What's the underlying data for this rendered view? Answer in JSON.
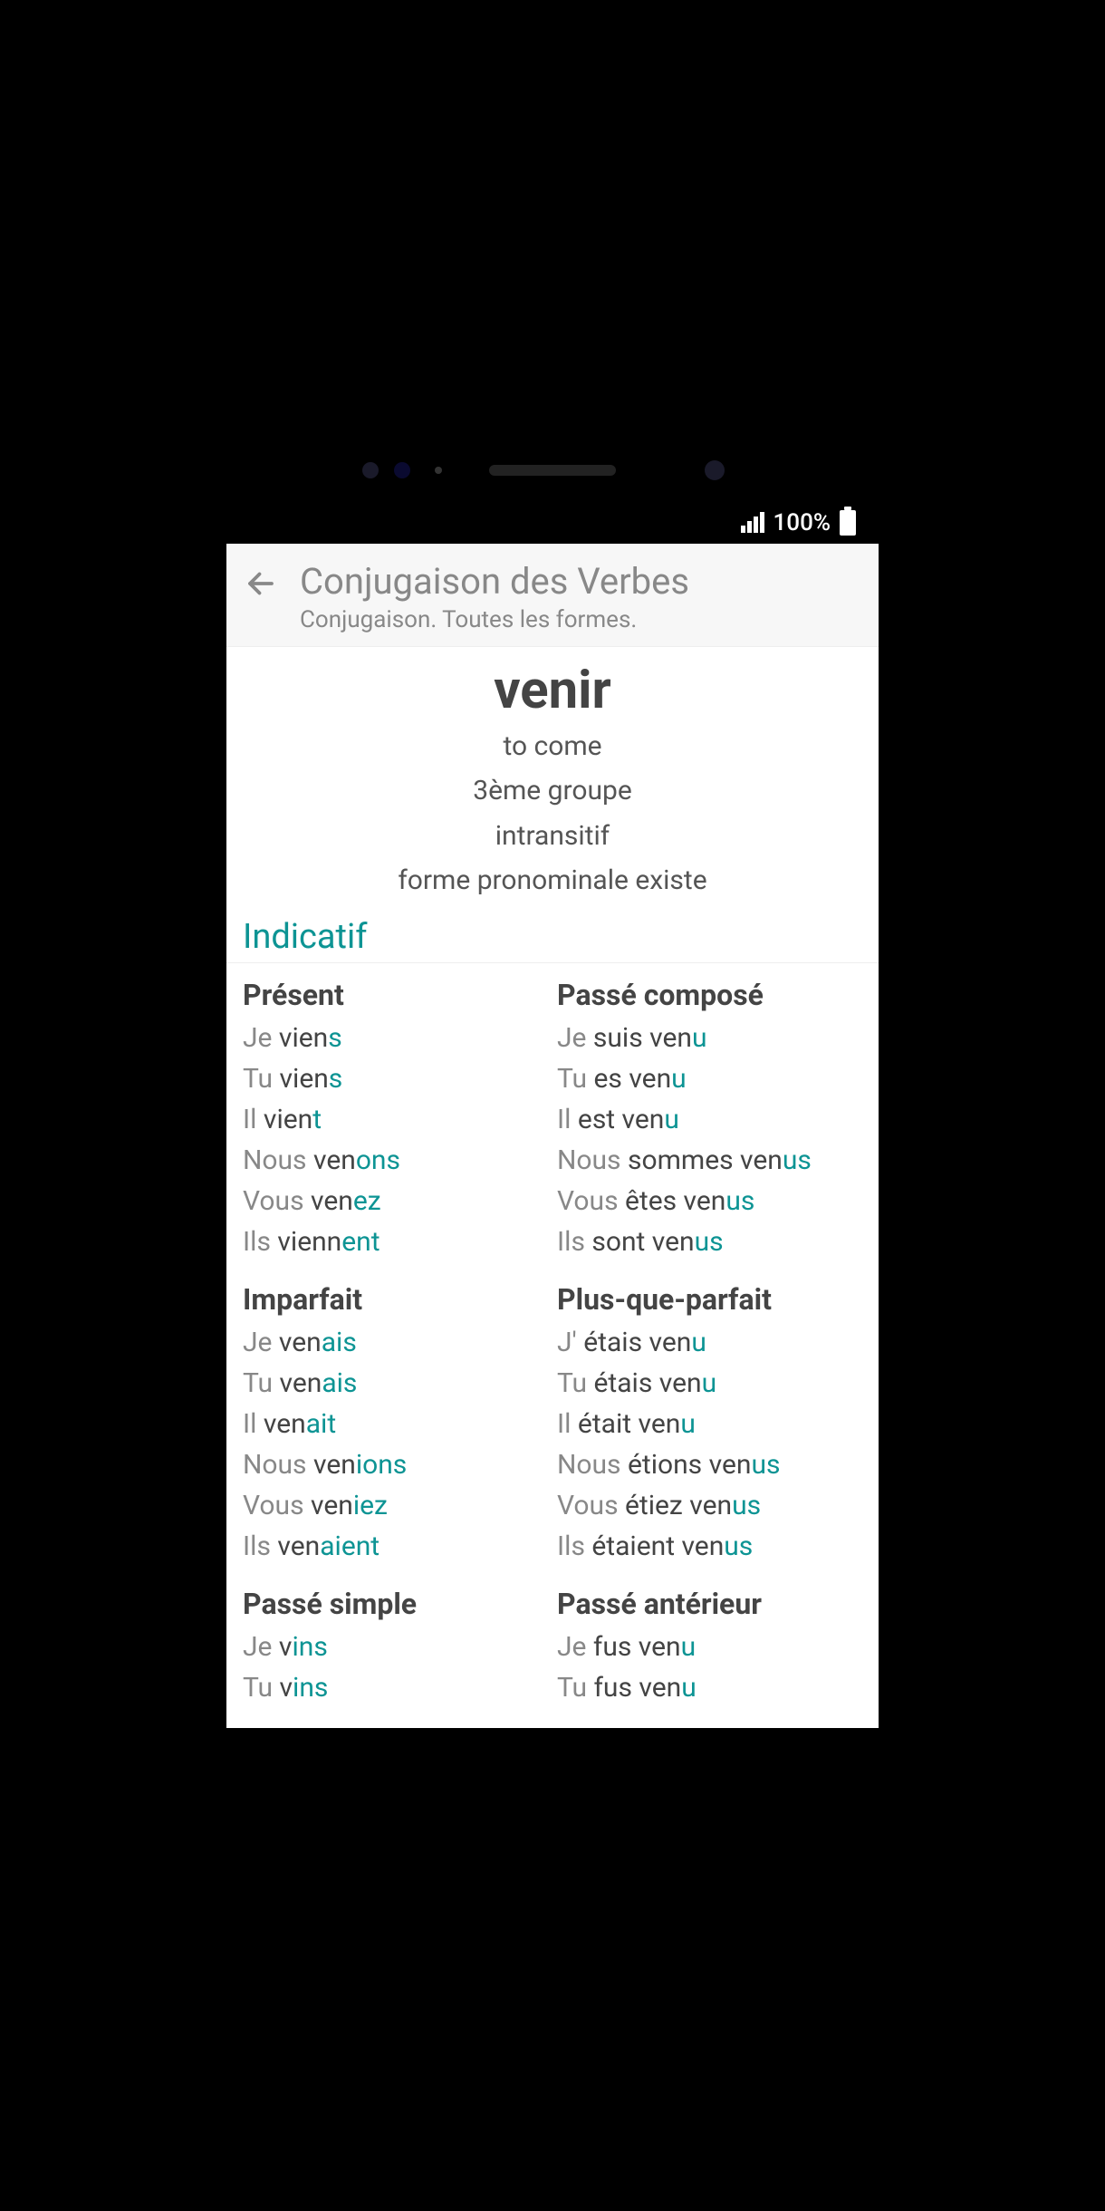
{
  "status": {
    "battery": "100%"
  },
  "header": {
    "title": "Conjugaison des Verbes",
    "subtitle": "Conjugaison. Toutes les formes."
  },
  "verb": {
    "infinitive": "venir",
    "translation": "to come",
    "group": "3ème groupe",
    "transitivity": "intransitif",
    "pronominal": "forme pronominale existe"
  },
  "mood": "Indicatif",
  "tenses": [
    {
      "name": "Présent",
      "forms": [
        {
          "pronoun": "Je",
          "stem": " vien",
          "ending": "s"
        },
        {
          "pronoun": "Tu",
          "stem": " vien",
          "ending": "s"
        },
        {
          "pronoun": "Il",
          "stem": " vien",
          "ending": "t"
        },
        {
          "pronoun": "Nous",
          "stem": " ven",
          "ending": "ons"
        },
        {
          "pronoun": "Vous",
          "stem": " ven",
          "ending": "ez"
        },
        {
          "pronoun": "Ils",
          "stem": " vienn",
          "ending": "ent"
        }
      ]
    },
    {
      "name": "Passé composé",
      "forms": [
        {
          "pronoun": "Je",
          "stem": " suis ven",
          "ending": "u"
        },
        {
          "pronoun": "Tu",
          "stem": " es ven",
          "ending": "u"
        },
        {
          "pronoun": "Il",
          "stem": " est ven",
          "ending": "u"
        },
        {
          "pronoun": "Nous",
          "stem": " sommes ven",
          "ending": "us"
        },
        {
          "pronoun": "Vous",
          "stem": " êtes ven",
          "ending": "us"
        },
        {
          "pronoun": "Ils",
          "stem": " sont ven",
          "ending": "us"
        }
      ]
    },
    {
      "name": "Imparfait",
      "forms": [
        {
          "pronoun": "Je",
          "stem": " ven",
          "ending": "ais"
        },
        {
          "pronoun": "Tu",
          "stem": " ven",
          "ending": "ais"
        },
        {
          "pronoun": "Il",
          "stem": " ven",
          "ending": "ait"
        },
        {
          "pronoun": "Nous",
          "stem": " ven",
          "ending": "ions"
        },
        {
          "pronoun": "Vous",
          "stem": " ven",
          "ending": "iez"
        },
        {
          "pronoun": "Ils",
          "stem": " ven",
          "ending": "aient"
        }
      ]
    },
    {
      "name": "Plus-que-parfait",
      "forms": [
        {
          "pronoun": "J'",
          "stem": " étais ven",
          "ending": "u"
        },
        {
          "pronoun": "Tu",
          "stem": " étais ven",
          "ending": "u"
        },
        {
          "pronoun": "Il",
          "stem": " était ven",
          "ending": "u"
        },
        {
          "pronoun": "Nous",
          "stem": " étions ven",
          "ending": "us"
        },
        {
          "pronoun": "Vous",
          "stem": " étiez ven",
          "ending": "us"
        },
        {
          "pronoun": "Ils",
          "stem": " étaient ven",
          "ending": "us"
        }
      ]
    },
    {
      "name": "Passé simple",
      "forms": [
        {
          "pronoun": "Je",
          "stem": " v",
          "ending": "ins"
        },
        {
          "pronoun": "Tu",
          "stem": " v",
          "ending": "ins"
        }
      ]
    },
    {
      "name": "Passé antérieur",
      "forms": [
        {
          "pronoun": "Je",
          "stem": " fus ven",
          "ending": "u"
        },
        {
          "pronoun": "Tu",
          "stem": " fus ven",
          "ending": "u"
        }
      ]
    }
  ]
}
